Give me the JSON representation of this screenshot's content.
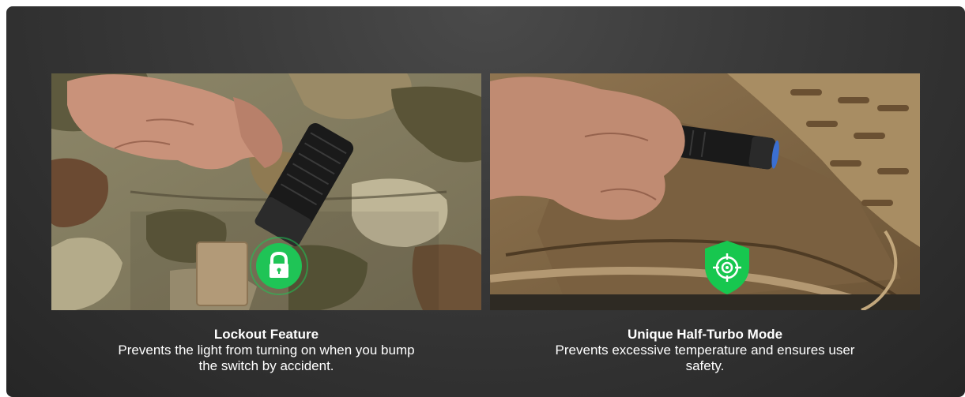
{
  "features": [
    {
      "title": "Lockout Feature",
      "description": "Prevents the light from turning on when you bump the switch by accident.",
      "icon": "lock-icon",
      "badge_color": "#1fc456"
    },
    {
      "title": "Unique Half-Turbo Mode",
      "description": "Prevents excessive temperature and ensures user safety.",
      "icon": "shield-target-icon",
      "badge_color": "#17c74f"
    }
  ],
  "colors": {
    "background": "#2e2e2e",
    "text": "#ffffff"
  }
}
